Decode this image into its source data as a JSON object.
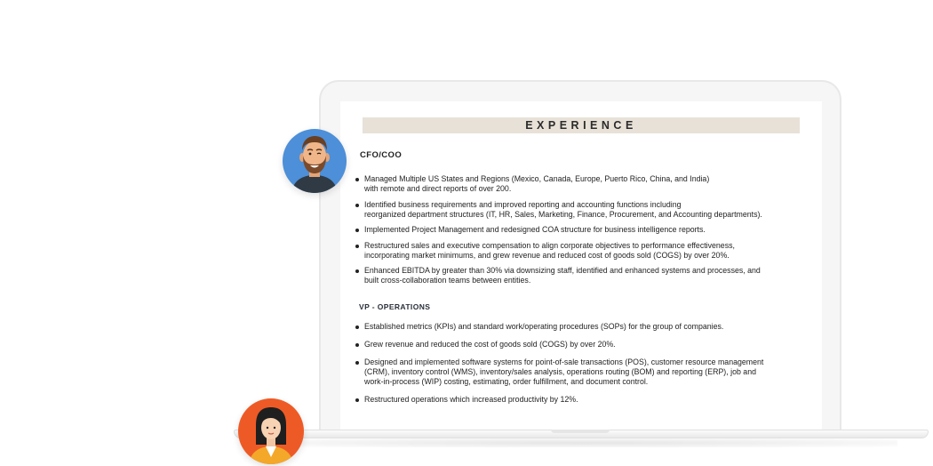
{
  "resume": {
    "section_title": "EXPERIENCE",
    "jobs": [
      {
        "title": "CFO/COO",
        "bullets": [
          "Managed Multiple US States and Regions (Mexico, Canada, Europe, Puerto Rico, China, and India)\nwith remote and direct reports of over 200.",
          "Identified business requirements and improved reporting and accounting functions including\nreorganized department structures (IT, HR, Sales, Marketing, Finance, Procurement, and Accounting departments).",
          "Implemented Project Management and redesigned COA structure for business intelligence reports.",
          "Restructured sales and executive compensation to align corporate objectives to performance effectiveness,\nincorporating market minimums, and grew revenue and reduced cost of goods sold (COGS) by over 20%.",
          "Enhanced EBITDA by greater than 30% via downsizing staff, identified and enhanced systems and processes, and\nbuilt cross-collaboration teams between entities."
        ]
      },
      {
        "title": "VP - OPERATIONS",
        "bullets": [
          "Established metrics (KPIs) and standard work/operating procedures (SOPs) for the group of companies.",
          "Grew revenue and reduced the cost of goods sold (COGS) by over 20%.",
          "Designed and implemented software systems for point-of-sale transactions (POS), customer resource management\n(CRM), inventory control (WMS), inventory/sales analysis, operations routing (BOM) and reporting (ERP), job and\nwork-in-process (WIP) costing, estimating, order fulfillment, and document control.",
          "Restructured operations which increased productivity by 12%."
        ]
      }
    ]
  },
  "avatars": {
    "man_bg": "#4d8fd8",
    "woman_bg": "#ee5a26"
  }
}
